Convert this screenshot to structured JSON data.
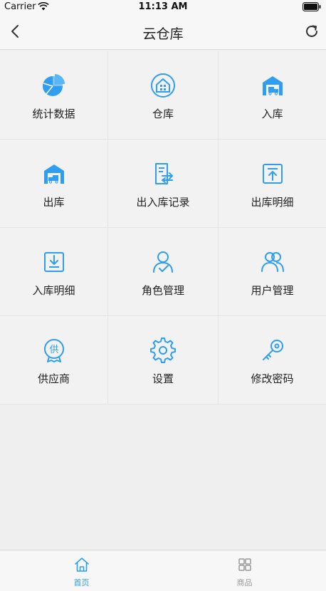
{
  "status_bar": {
    "carrier": "Carrier",
    "time": "11:13 AM"
  },
  "nav": {
    "title": "云仓库",
    "back_icon": "chevron-left-icon",
    "refresh_icon": "refresh-icon"
  },
  "accent_color": "#2f9ef0",
  "grid": [
    {
      "label": "统计数据",
      "icon": "pie-chart-icon"
    },
    {
      "label": "仓库",
      "icon": "warehouse-icon"
    },
    {
      "label": "入库",
      "icon": "truck-in-icon"
    },
    {
      "label": "出库",
      "icon": "truck-out-icon"
    },
    {
      "label": "出入库记录",
      "icon": "transfer-record-icon"
    },
    {
      "label": "出库明细",
      "icon": "upload-box-icon"
    },
    {
      "label": "入库明细",
      "icon": "download-box-icon"
    },
    {
      "label": "角色管理",
      "icon": "user-check-icon"
    },
    {
      "label": "用户管理",
      "icon": "users-icon"
    },
    {
      "label": "供应商",
      "icon": "supplier-badge-icon"
    },
    {
      "label": "设置",
      "icon": "gear-icon"
    },
    {
      "label": "修改密码",
      "icon": "key-icon"
    }
  ],
  "tabs": [
    {
      "label": "首页",
      "icon": "home-icon",
      "active": true
    },
    {
      "label": "商品",
      "icon": "grid-icon",
      "active": false
    }
  ]
}
